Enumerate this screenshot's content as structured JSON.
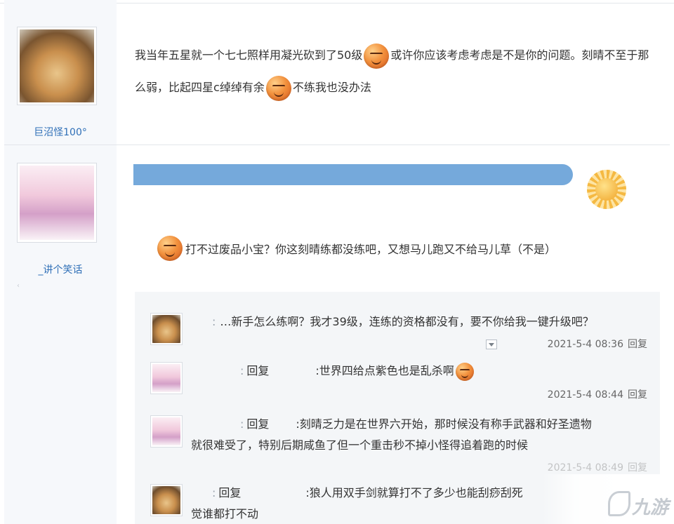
{
  "posts": [
    {
      "username": "巨沼怪100°",
      "text_part1": "我当年五星就一个七七照样用凝光砍到了50级",
      "text_part2": "或许你应该考虑考虑是不是你的问题。刻晴不至于那么弱，比起四星c绰绰有余",
      "text_part3": "不练我也没办法"
    },
    {
      "username": "_讲个笑话",
      "side_mark": "‹",
      "text": "打不过废品小宝？你这刻晴练都没练吧，又想马儿跑又不给马儿草（不是）"
    }
  ],
  "replies": [
    {
      "prefix": ":",
      "text": "…新手怎么练啊？我才39级，连练的资格都没有，要不你给我一键升级吧？",
      "time": "2021-5-4 08:36",
      "reply_label": "回复"
    },
    {
      "prefix": ":",
      "reply_word": "回复",
      "text": ":世界四给点紫色也是乱杀啊",
      "time": "2021-5-4 08:44",
      "reply_label": "回复"
    },
    {
      "prefix": ":",
      "reply_word": "回复",
      "text_line1": ":刻晴乏力是在世界六开始，那时候没有称手武器和好圣遗物",
      "text_line2": "就很难受了，特别后期咸鱼了但一个重击秒不掉小怪得追着跑的时候",
      "time_partial": "2021-5-4 08:49",
      "reply_label": "回复"
    },
    {
      "prefix": ":",
      "reply_word": "回复",
      "text_line1": ":狼人用双手剑就算打不了多少也能刮痧刮死",
      "text_line2": "觉谁都打不动"
    }
  ],
  "watermark": {
    "text": "九游"
  },
  "colors": {
    "username": "#2f6fb7",
    "banner": "#75a9db",
    "reply_bg": "#f4f6f8"
  }
}
